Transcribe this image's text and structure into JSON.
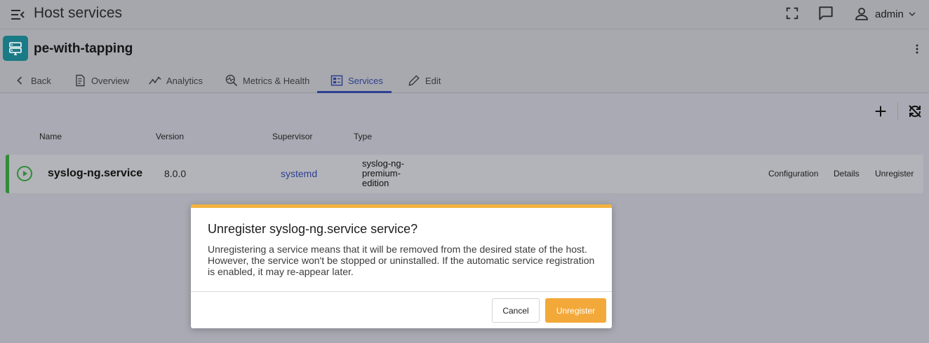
{
  "topbar": {
    "title": "Host services",
    "user_name": "admin",
    "icons": [
      "menu-collapse-icon",
      "fullscreen-icon",
      "chat-icon",
      "user-icon",
      "chevron-down-icon"
    ]
  },
  "host": {
    "name": "pe-with-tapping",
    "avatar_color": "#1a7a86"
  },
  "tabs": [
    {
      "label": "Back",
      "icon": "chevron-left-icon"
    },
    {
      "label": "Overview",
      "icon": "document-icon"
    },
    {
      "label": "Analytics",
      "icon": "analytics-icon"
    },
    {
      "label": "Metrics & Health",
      "icon": "metrics-health-icon"
    },
    {
      "label": "Services",
      "icon": "services-icon",
      "active": true
    },
    {
      "label": "Edit",
      "icon": "pencil-icon"
    }
  ],
  "table": {
    "columns": [
      "Name",
      "Version",
      "Supervisor",
      "Type"
    ],
    "rows": [
      {
        "name": "syslog-ng.service",
        "version": "8.0.0",
        "supervisor": "systemd",
        "type": "syslog-ng-premium-edition",
        "status_color": "#2f8d36",
        "actions": [
          "Configuration",
          "Details",
          "Unregister"
        ]
      }
    ]
  },
  "dialog": {
    "title": "Unregister syslog-ng.service service?",
    "body": "Unregistering a service means that it will be removed from the desired state of the host. However, the service won't be stopped or uninstalled. If the automatic service registration is enabled, it may re-appear later.",
    "cancel_label": "Cancel",
    "confirm_label": "Unregister",
    "accent_color": "#f2b33d"
  },
  "colors": {
    "accent_blue": "#2d3f92",
    "confirm_orange": "#f3a93a",
    "status_green": "#2f8d36"
  }
}
